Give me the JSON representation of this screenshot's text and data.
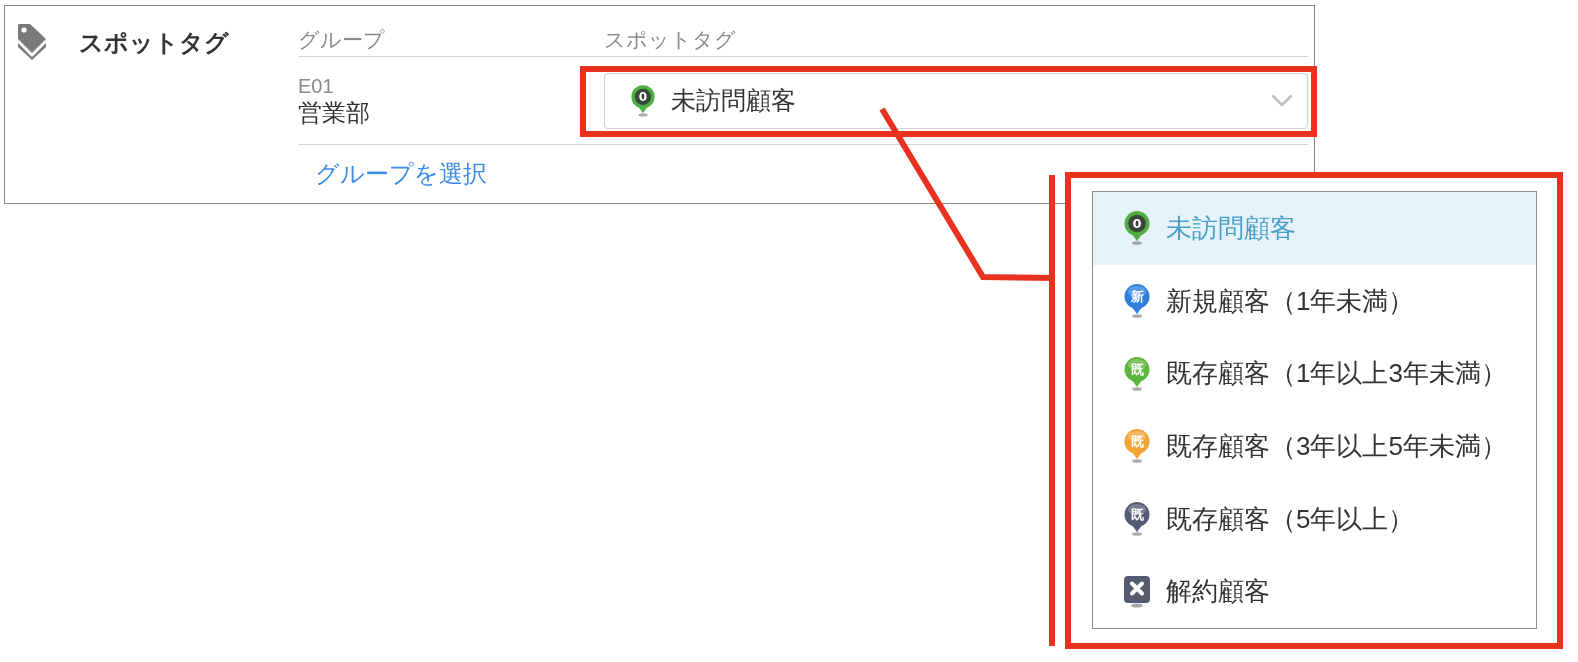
{
  "section": {
    "title": "スポットタグ"
  },
  "table": {
    "columns": [
      "グループ",
      "スポットタグ"
    ],
    "rows": [
      {
        "group_code": "E01",
        "group_name": "営業部",
        "spot_tag": {
          "kind": "ring-pin",
          "badge": "0",
          "color": "#4fae42",
          "label": "未訪問顧客"
        }
      }
    ],
    "add_link": "グループを選択"
  },
  "dropdown": {
    "options": [
      {
        "kind": "ring-pin",
        "badge": "0",
        "color": "#4fae42",
        "label": "未訪問顧客",
        "selected": true
      },
      {
        "kind": "pin",
        "badge": "新",
        "color": "#2e7fe0",
        "label": "新規顧客（1年未満）",
        "selected": false
      },
      {
        "kind": "pin",
        "badge": "既",
        "color": "#5cb53c",
        "label": "既存顧客（1年以上3年未満）",
        "selected": false
      },
      {
        "kind": "pin",
        "badge": "既",
        "color": "#f2a436",
        "label": "既存顧客（3年以上5年未満）",
        "selected": false
      },
      {
        "kind": "pin",
        "badge": "既",
        "color": "#535a71",
        "label": "既存顧客（5年以上）",
        "selected": false
      },
      {
        "kind": "square",
        "color": "#565c70",
        "label": "解約顧客",
        "selected": false
      }
    ]
  }
}
